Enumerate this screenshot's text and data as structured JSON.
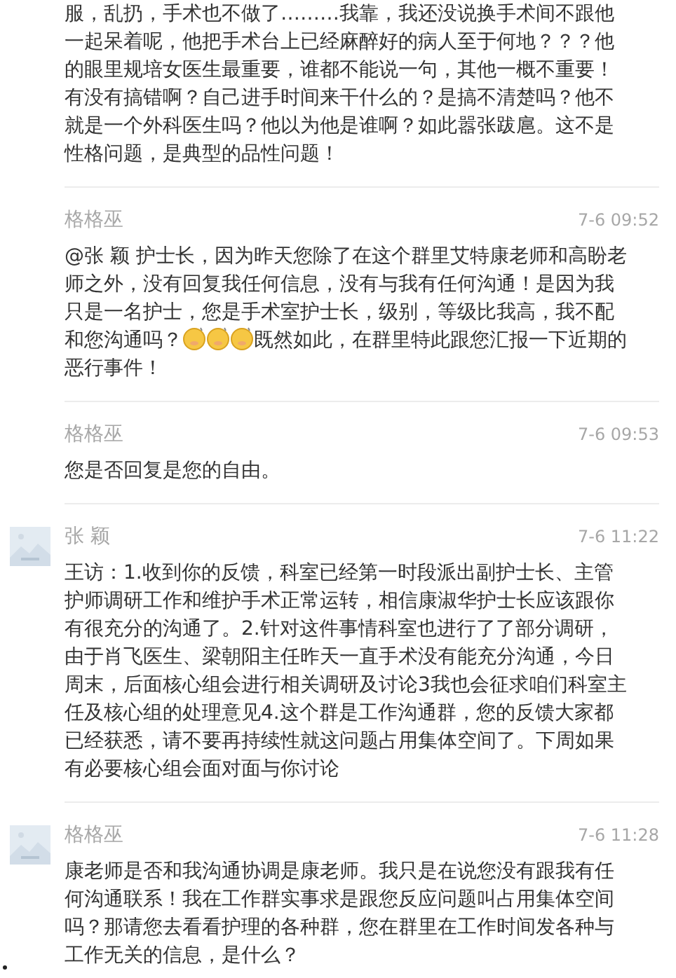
{
  "messages": [
    {
      "avatar": false,
      "parts": [
        {
          "kind": "text",
          "text": "服，乱扔，手术也不做了………我靠，我还没说换手术间不跟他一起呆着呢，他把手术台上已经麻醉好的病人至于何地？？？他的眼里规培女医生最重要，谁都不能说一句，其他一概不重要！有没有搞错啊？自己进手时间来干什么的？是搞不清楚吗？他不就是一个外科医生吗？他以为他是谁啊？如此嚣张跋扈。这不是性格问题，是典型的品性问题！"
        }
      ]
    },
    {
      "sender": "格格巫",
      "time": "7-6 09:52",
      "avatar": false,
      "parts": [
        {
          "kind": "text",
          "text": "@张 颖 护士长，因为昨天您除了在这个群里艾特康老师和高盼老师之外，没有回复我任何信息，没有与我有任何沟通！是因为我只是一名护士，您是手术室护士长，级别，等级比我高，我不配和您沟通吗？"
        },
        {
          "kind": "emoji"
        },
        {
          "kind": "emoji"
        },
        {
          "kind": "emoji"
        },
        {
          "kind": "text",
          "text": "既然如此，在群里特此跟您汇报一下近期的恶行事件！"
        }
      ]
    },
    {
      "sender": "格格巫",
      "time": "7-6 09:53",
      "avatar": false,
      "parts": [
        {
          "kind": "text",
          "text": "您是否回复是您的自由。"
        }
      ]
    },
    {
      "sender": "张 颖",
      "time": "7-6 11:22",
      "avatar": true,
      "parts": [
        {
          "kind": "text",
          "text": "王访：1.收到你的反馈，科室已经第一时段派出副护士长、主管护师调研工作和维护手术正常运转，相信康淑华护士长应该跟你有很充分的沟通了。2.针对这件事情科室也进行了了部分调研，由于肖飞医生、梁朝阳主任昨天一直手术没有能充分沟通，今日周末，后面核心组会进行相关调研及讨论3我也会征求咱们科室主任及核心组的处理意见4.这个群是工作沟通群，您的反馈大家都已经获悉，请不要再持续性就这问题占用集体空间了。下周如果有必要核心组会面对面与你讨论"
        }
      ]
    },
    {
      "sender": "格格巫",
      "time": "7-6 11:28",
      "avatar": true,
      "parts": [
        {
          "kind": "text",
          "text": "康老师是否和我沟通协调是康老师。我只是在说您没有跟我有任何沟通联系！我在工作群实事求是跟您反应问题叫占用集体空间吗？那请您去看看护理的各种群，您在群里在工作时间发各种与工作无关的信息，是什么？"
        }
      ]
    }
  ]
}
